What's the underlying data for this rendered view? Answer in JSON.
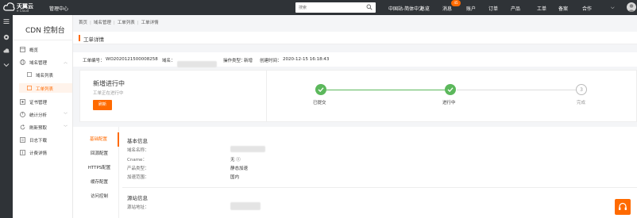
{
  "topbar": {
    "logo_main": "天翼云",
    "logo_sub": "e Cloud",
    "mgmt_center": "管理中心",
    "search_placeholder": "搜索",
    "region": "中国站-简体中文",
    "nav": [
      "总览",
      "消息",
      "账户",
      "订单",
      "产品",
      "工单",
      "备案",
      "合作"
    ],
    "message_badge": "45"
  },
  "sidebar": {
    "title": "CDN 控制台",
    "items": [
      {
        "label": "概览"
      },
      {
        "label": "域名管理"
      },
      {
        "label": "域名列表"
      },
      {
        "label": "工单列表"
      },
      {
        "label": "证书管理"
      },
      {
        "label": "统计分析"
      },
      {
        "label": "刷新预取"
      },
      {
        "label": "日志下载"
      },
      {
        "label": "计费详情"
      }
    ]
  },
  "breadcrumb": [
    "首页",
    "域名管理",
    "工单列表",
    "工单详情"
  ],
  "page": {
    "title": "工单详情"
  },
  "ticket": {
    "id_label": "工单编号：",
    "id_value": "WO2020121500008258",
    "domain_label": "域名：",
    "op_label": "操作类型：",
    "op_value": "新增",
    "created_label": "创建时间：",
    "created_value": "2020-12-15 16:18:43"
  },
  "status": {
    "title": "新增进行中",
    "subtitle": "工单正在进行中",
    "button": "刷新",
    "steps": [
      {
        "label": "已提交",
        "state": "done"
      },
      {
        "label": "进行中",
        "state": "done"
      },
      {
        "label": "完成",
        "state": "todo",
        "num": "3"
      }
    ]
  },
  "tabs": [
    "基础配置",
    "回源配置",
    "HTTPS配置",
    "缓存配置",
    "访问控制"
  ],
  "basic": {
    "title": "基本信息",
    "rows": [
      {
        "key": "域名名称：",
        "value": ""
      },
      {
        "key": "Cname：",
        "value": "无 Ⓘ"
      },
      {
        "key": "产品类型：",
        "value": "静态加速"
      },
      {
        "key": "加速范围：",
        "value": "国内"
      }
    ]
  },
  "origin": {
    "title": "源站信息",
    "rows": [
      {
        "key": "源站地址：",
        "value": ""
      }
    ]
  },
  "colors": {
    "accent": "#ff6a00",
    "success": "#5cb85c",
    "topbar": "#2f3337"
  }
}
